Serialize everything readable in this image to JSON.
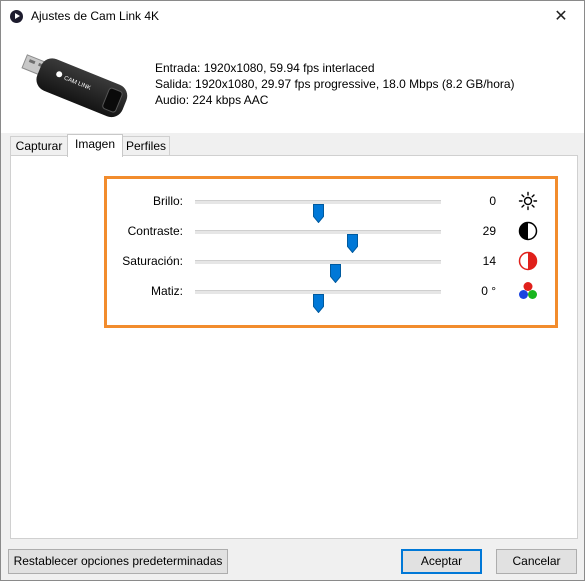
{
  "window": {
    "title": "Ajustes de Cam Link 4K",
    "close_glyph": "✕"
  },
  "info": {
    "input": "Entrada: 1920x1080, 59.94 fps interlaced",
    "output": "Salida: 1920x1080, 29.97 fps progressive, 18.0 Mbps (8.2 GB/hora)",
    "audio": "Audio: 224 kbps AAC"
  },
  "device": {
    "brand_text": "CAM LINK"
  },
  "tabs": [
    {
      "label": "Capturar",
      "active": false
    },
    {
      "label": "Imagen",
      "active": true
    },
    {
      "label": "Perfiles",
      "active": false
    }
  ],
  "sliders": [
    {
      "label": "Brillo:",
      "value": "0",
      "level": 0.5,
      "icon": "sun-icon"
    },
    {
      "label": "Contraste:",
      "value": "29",
      "level": 0.64,
      "icon": "contrast-icon"
    },
    {
      "label": "Saturación:",
      "value": "14",
      "level": 0.57,
      "icon": "saturation-icon"
    },
    {
      "label": "Matiz:",
      "value": "0 °",
      "level": 0.5,
      "icon": "hue-icon"
    }
  ],
  "buttons": {
    "reset": "Restablecer opciones predeterminadas",
    "accept": "Aceptar",
    "cancel": "Cancelar"
  },
  "colors": {
    "accent": "#0078d7",
    "highlight": "#f28c2d",
    "saturation": "#e0201b"
  }
}
